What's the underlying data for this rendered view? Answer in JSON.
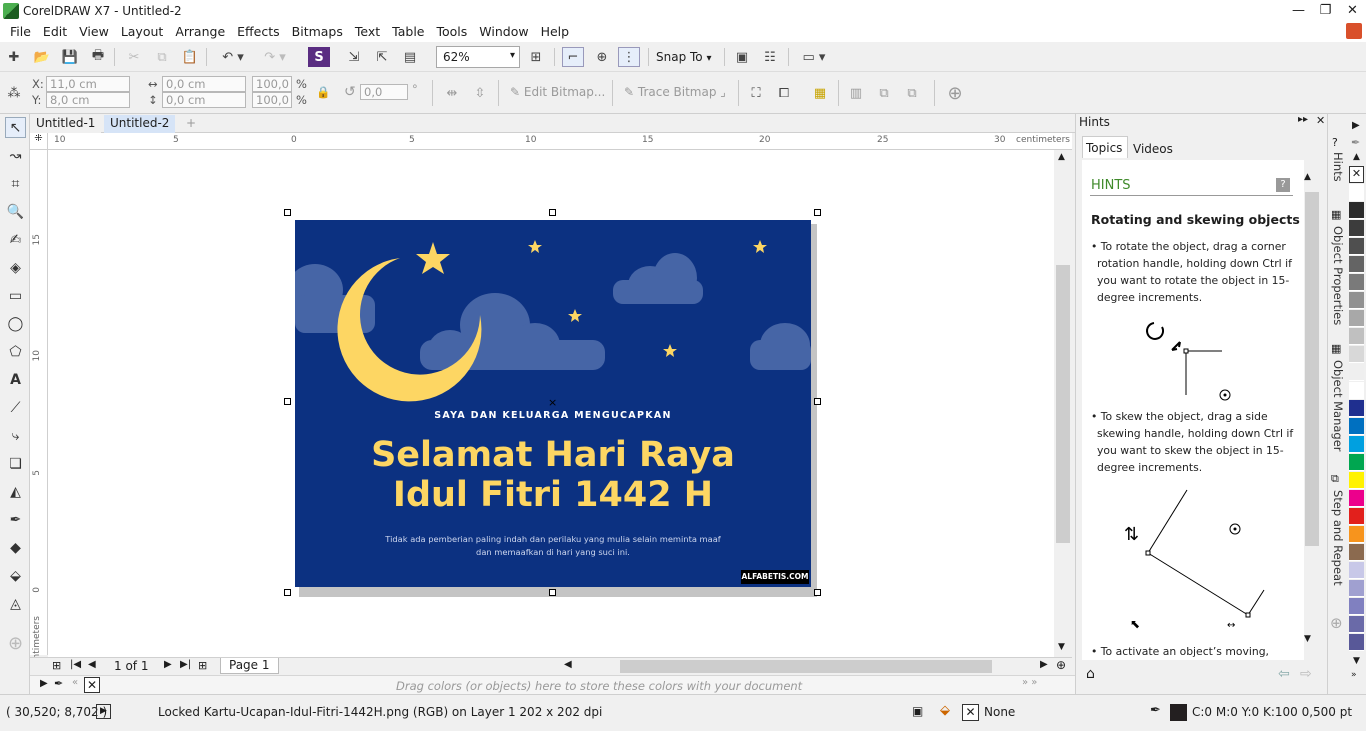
{
  "window": {
    "title": "CorelDRAW X7 - Untitled-2",
    "min": "—",
    "restore": "❐",
    "close": "✕"
  },
  "menu": [
    "File",
    "Edit",
    "View",
    "Layout",
    "Arrange",
    "Effects",
    "Bitmaps",
    "Text",
    "Table",
    "Tools",
    "Window",
    "Help"
  ],
  "toolbar": {
    "zoom": "62%",
    "snap": "Snap To"
  },
  "propbar": {
    "x_label": "X:",
    "x": "11,0 cm",
    "y_label": "Y:",
    "y": "8,0 cm",
    "w": "0,0 cm",
    "h": "0,0 cm",
    "sx": "100,0",
    "sy": "100,0",
    "pct": "%",
    "rot": "0,0",
    "deg": "°",
    "edit_bitmap": "Edit Bitmap...",
    "trace_bitmap": "Trace Bitmap"
  },
  "tabs": [
    "Untitled-1",
    "Untitled-2"
  ],
  "tabs_add": "+",
  "ruler": {
    "units": "centimeters",
    "h_ticks": [
      "10",
      "5",
      "0",
      "5",
      "10",
      "15",
      "20",
      "25",
      "30"
    ],
    "v_ticks": [
      "15",
      "10",
      "5",
      "0"
    ]
  },
  "pagenav": {
    "count": "1 of 1",
    "page": "Page 1"
  },
  "docpalette": {
    "hint": "Drag colors (or objects) here to store these colors with your document"
  },
  "card": {
    "subtitle": "SAYA DAN KELUARGA MENGUCAPKAN",
    "title1": "Selamat Hari Raya",
    "title2": "Idul Fitri 1442 H",
    "body1": "Tidak ada pemberian paling indah dan perilaku yang mulia selain meminta maaf",
    "body2": "dan memaafkan di hari yang suci ini.",
    "brand": "ALFABETIS.COM",
    "bg": "#0c3181",
    "accent": "#fdd663"
  },
  "hints": {
    "panel_title": "Hints",
    "tab_topics": "Topics",
    "tab_videos": "Videos",
    "header": "HINTS",
    "help": "?",
    "heading": "Rotating and skewing objects",
    "p1": [
      "• To rotate the object, drag a corner",
      "rotation handle, holding down Ctrl if",
      "you want to rotate the object in 15-",
      "degree increments."
    ],
    "p2": [
      "• To skew the object, drag a side",
      "skewing handle, holding down Ctrl if",
      "you want to skew the object in 15-",
      "degree increments."
    ],
    "p3": "• To activate an object’s moving,"
  },
  "dockers": [
    "Hints",
    "Object Properties",
    "Object Manager",
    "Step and Repeat"
  ],
  "palette_colors": [
    "#ffffff",
    "#2b2b2b",
    "#3c3c3c",
    "#4f4f4f",
    "#646464",
    "#7a7a7a",
    "#919191",
    "#a8a8a8",
    "#c0c0c0",
    "#d8d8d8",
    "#efefef",
    "#ffffff",
    "#1f2f8f",
    "#0070c0",
    "#00a0e0",
    "#00a650",
    "#fff200",
    "#ec008c",
    "#e2201c",
    "#f7941d",
    "#8b6a4f",
    "#c8c8e8",
    "#a0a0d0",
    "#8080c0",
    "#6a6aa8",
    "#585898"
  ],
  "status": {
    "coords": "( 30,520; 8,702 )",
    "info": "Locked Kartu-Ucapan-Idul-Fitri-1442H.png (RGB) on Layer 1 202 x 202 dpi",
    "fill": "None",
    "outline": "C:0 M:0 Y:0 K:100  0,500 pt"
  }
}
